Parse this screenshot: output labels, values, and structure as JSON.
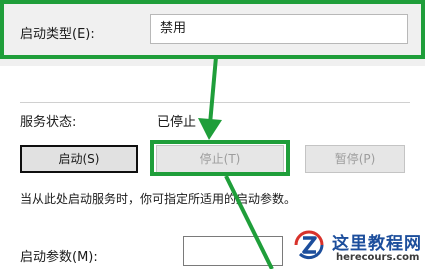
{
  "startup_type": {
    "label": "启动类型(E):",
    "value": "禁用"
  },
  "service_status": {
    "label": "服务状态:",
    "value": "已停止"
  },
  "buttons": {
    "start": "启动(S)",
    "stop": "停止(T)",
    "pause": "暂停(P)"
  },
  "hint": "当从此处启动服务时，你可指定所适用的启动参数。",
  "start_params": {
    "label": "启动参数(M):",
    "value": ""
  },
  "watermark": {
    "title": "这里教程网",
    "domain": "herecours.com"
  },
  "colors": {
    "highlight": "#1f9e3a",
    "watermark_blue": "#1c4e9c",
    "watermark_red": "#d8322b"
  }
}
